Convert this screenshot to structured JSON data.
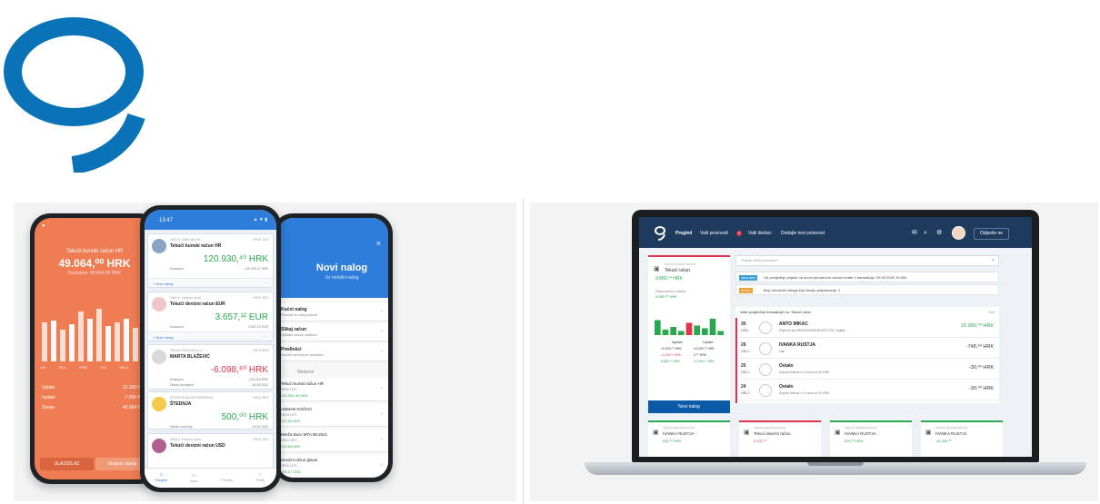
{
  "phone_left": {
    "title": "Tekući kunski račun HR",
    "balance": "49.064,⁰⁰ HRK",
    "sub": "Dostupno: 49.064,00 HRK",
    "months": [
      "LIS",
      "STU",
      "PRO",
      "SIJ",
      "VELJ",
      "OŽU"
    ],
    "bar_values": [
      0.55,
      0.58,
      0.45,
      0.52,
      0.7,
      0.6,
      0.75,
      0.5,
      0.55,
      0.6,
      0.48,
      0.55
    ],
    "list_label": "Uplate",
    "list_value": "12.200 HRK",
    "list_label2": "Isplate",
    "list_value2": "-7.500 HRK",
    "list_label3": "Stanje",
    "list_value3": "49.064 HRK",
    "button_left": "ULAZ/IZLAZ",
    "button_right": "Ukupno stanje"
  },
  "phone_mid": {
    "status_time": "13:47",
    "status_icons": "▲ ▼ ▮",
    "accounts": [
      {
        "owner": "IVAN K. MARJAN HR...",
        "kind": "Tekući kunski račun HR",
        "date": "HR10 1871",
        "amount": "120.930,⁴⁰ HRK",
        "sub_label": "Dostupno",
        "sub_value": "120.930,21 HRK",
        "action": "+ Novi nalog"
      },
      {
        "owner": "IVAN K. Devizni račun",
        "kind": "Tekući devizni račun EUR",
        "date": "HR10 1871",
        "amount": "3.657,¹² EUR",
        "sub_label": "Dostupno",
        "sub_value": "3.657,12 EUR",
        "action": "+ Novi nalog"
      },
      {
        "owner": "TEKUĆI RAČUN d.o.o.",
        "kind": "MARTA BLAŽEVIĆ",
        "date": "HR70 8814",
        "amount": "-6.098,⁸⁰ HRK",
        "sub_label": "Dostupno",
        "sub_value": "120.215 HRK",
        "sub_label2": "Datum dospijeća",
        "sub_value2": "30.03.2022",
        "action": ""
      },
      {
        "owner": "ŠTEDNJA NA NEODREĐENO",
        "kind": "ŠTEDNJA",
        "date": "HR10 4871",
        "amount": "500,⁰⁰ HRK",
        "sub_label": "Datum oročenja",
        "sub_value": "25.04.2022",
        "action": ""
      },
      {
        "owner": "IVAN K. Devizni račun",
        "kind": "Tekući devizni račun USD",
        "date": "HR10 1871",
        "amount": "",
        "sub_label": "",
        "sub_value": "",
        "action": ""
      }
    ],
    "tabs": [
      "Pregled",
      "Novi",
      "Poruke",
      "Profil"
    ]
  },
  "phone_right": {
    "header": "Novi nalog",
    "header_sub": "Uz mobilni nalog",
    "items": [
      {
        "title": "Kućni nalog",
        "sub": "Plaćanje sa vašeg računa"
      },
      {
        "title": "Slikaj račun",
        "sub": "Uslikajte barkod uplatnice"
      },
      {
        "title": "Predlošci",
        "sub": "Koristite spremljene predloške"
      }
    ],
    "section": "Nedavni",
    "recent": [
      {
        "title": "Tekući kunski račun HR",
        "sub": "HR10 1871 ...",
        "amount": "120.930,40 HRK"
      },
      {
        "title": "ADMAN KOČKO",
        "sub": "HR10 1871 ...",
        "amount": "127,50 HRK"
      },
      {
        "title": "Mreža Đuro MTA 08.2021",
        "sub": "HR10 1871 ...",
        "amount": "102,55 HRK"
      },
      {
        "title": "Devizni račun glavni",
        "sub": "HR10 1871 ...",
        "amount": "905,37 USD"
      }
    ]
  },
  "laptop": {
    "nav": [
      "Pregled",
      "Vaši proizvodi",
      "Vaši dodaci",
      "Dodajte novi proizvod"
    ],
    "nav_badge": "2",
    "logout": "Odjavite se",
    "account_card": {
      "label": "TEKUĆI KUNSKI RAČUN",
      "title": "Tekući račun",
      "balance": "9.880,⁰⁰ HRK",
      "sub_label": "Raspoloživo stanje",
      "sub_value": "9.880,⁰⁰ HRK"
    },
    "chart_values": [
      0.55,
      0.2,
      0.3,
      0.15,
      0.45,
      0.35,
      0.25,
      0.6,
      0.15
    ],
    "chart_colors": [
      "#2aa84f",
      "#2aa84f",
      "#2aa84f",
      "#2aa84f",
      "#e0344a",
      "#2aa84f",
      "#2aa84f",
      "#2aa84f",
      "#2aa84f"
    ],
    "table_head": [
      "Isplate",
      "Uplate"
    ],
    "table_rows": [
      [
        "10.000,⁰⁰ HRK",
        "10.000,⁰⁰ HRK"
      ],
      [
        "-1.240,⁰⁰ HRK",
        "0,⁰⁰ HRK"
      ],
      [
        "8.880,⁰⁰ HRK",
        "10.000,⁰⁰ HRK"
      ]
    ],
    "new_order": "Novi nalog",
    "search_placeholder": "Tražite nešto posebno?",
    "notices": [
      {
        "tag": "OBAVIJEST",
        "text": "Od posljednje prijave na ovom primarnom računu imate 1 transakciju: 09.03.2020 15:00h"
      },
      {
        "tag": "NALOG",
        "text": "Broj otvorenih naloga koji čekaju potpisivanje: 1"
      }
    ],
    "tx_title": "Vaše posljednje transakcije na: Tekući račun",
    "tx_more": "Sve",
    "transactions": [
      {
        "day": "30",
        "month": "OŽU",
        "name": "ANTO MIKAC",
        "desc": "Prijenos sa HR9024020063500270700. Uplata",
        "amount": "15.000,⁰⁰ HRK",
        "positive": true
      },
      {
        "day": "26",
        "month": "VELJ",
        "name": "IVANKA RUSTJA",
        "desc": "Isisi",
        "amount": "-748,⁸⁰ HRK",
        "positive": false
      },
      {
        "day": "25",
        "month": "VELJ",
        "name": "Ostalo",
        "desc": "Kupnja žetona ≥ 0 iznos od 30 HRK",
        "amount": "-30,⁰⁰ HRK",
        "positive": false
      },
      {
        "day": "24",
        "month": "VELJ",
        "name": "Ostalo",
        "desc": "Kupnja žetona ≥ 0 iznos od 30 HRK",
        "amount": "-30,⁰⁰ HRK",
        "positive": false
      }
    ],
    "bottom_cards": [
      {
        "label": "TEKUĆI DEVIZNI RAČUN",
        "name": "IVANKA RUSTJA",
        "value": "500,⁰⁰ HRK",
        "color": "#2aa84f"
      },
      {
        "label": "TEKUĆI DEVIZNI RAČUN",
        "name": "Tekući devizni račun",
        "value": "9.101,⁰⁰",
        "color": "#e0344a"
      },
      {
        "label": "TEKUĆI DEVIZNI RAČUN",
        "name": "IVANKA RUSTJA",
        "value": "500,⁰⁰ HRK",
        "color": "#2aa84f"
      },
      {
        "label": "TEKUĆI DEVIZNI RAČUN",
        "name": "IVANKA RUSTJA",
        "value": "-40.356,⁰⁰",
        "color": "#2aa84f"
      }
    ]
  },
  "colors": {
    "brand_blue": "#0a73b7",
    "orange": "#ef7c52",
    "green": "#2aa84f",
    "red": "#e0344a",
    "navy": "#1e3a5c"
  }
}
